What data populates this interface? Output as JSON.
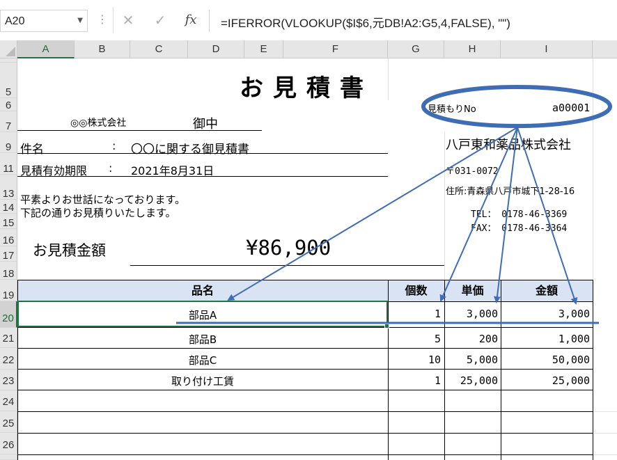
{
  "formula_bar": {
    "name_box": "A20",
    "cancel_icon": "✕",
    "enter_icon": "✓",
    "fx_label": "fx",
    "formula": "=IFERROR(VLOOKUP($I$6,元DB!A2:G5,4,FALSE), \"\")"
  },
  "columns": [
    "A",
    "B",
    "C",
    "D",
    "E",
    "F",
    "G",
    "H",
    "I"
  ],
  "selected_column": "A",
  "rows": [
    "5",
    "6",
    "7",
    "9",
    "11",
    "13",
    "14",
    "15",
    "16",
    "17",
    "18",
    "19",
    "20",
    "21",
    "22",
    "23",
    "24",
    "25",
    "26"
  ],
  "selected_row": "20",
  "sheet": {
    "title": "お見積書",
    "estimate_no_label": "見積もりNo",
    "estimate_no": "a00001",
    "client": "◎◎株式会社",
    "honorific": "御中",
    "subject_label": "件名",
    "subject_colon": ":",
    "subject": "〇〇に関する御見積書",
    "valid_label": "見積有効期限",
    "valid_colon": ":",
    "valid_date": "2021年8月31日",
    "greeting_1": "平素よりお世話になっております。",
    "greeting_2": "下記の通りお見積りいたします。",
    "company": "八戸東和薬品株式会社",
    "postal": "〒031-0072",
    "address": "住所:青森県八戸市城下1-28-16",
    "tel": "TEL： 0178-46-3369",
    "fax": "FAX： 0178-46-3364",
    "amount_label": "お見積金額",
    "amount": "¥86,900"
  },
  "table": {
    "headers": {
      "name": "品名",
      "qty": "個数",
      "price": "単価",
      "total": "金額"
    },
    "rows": [
      {
        "name": "部品A",
        "qty": "1",
        "price": "3,000",
        "total": "3,000"
      },
      {
        "name": "部品B",
        "qty": "5",
        "price": "200",
        "total": "1,000"
      },
      {
        "name": "部品C",
        "qty": "10",
        "price": "5,000",
        "total": "50,000"
      },
      {
        "name": "取り付け工賃",
        "qty": "1",
        "price": "25,000",
        "total": "25,000"
      }
    ]
  },
  "annotation_color": "#3e6db5"
}
